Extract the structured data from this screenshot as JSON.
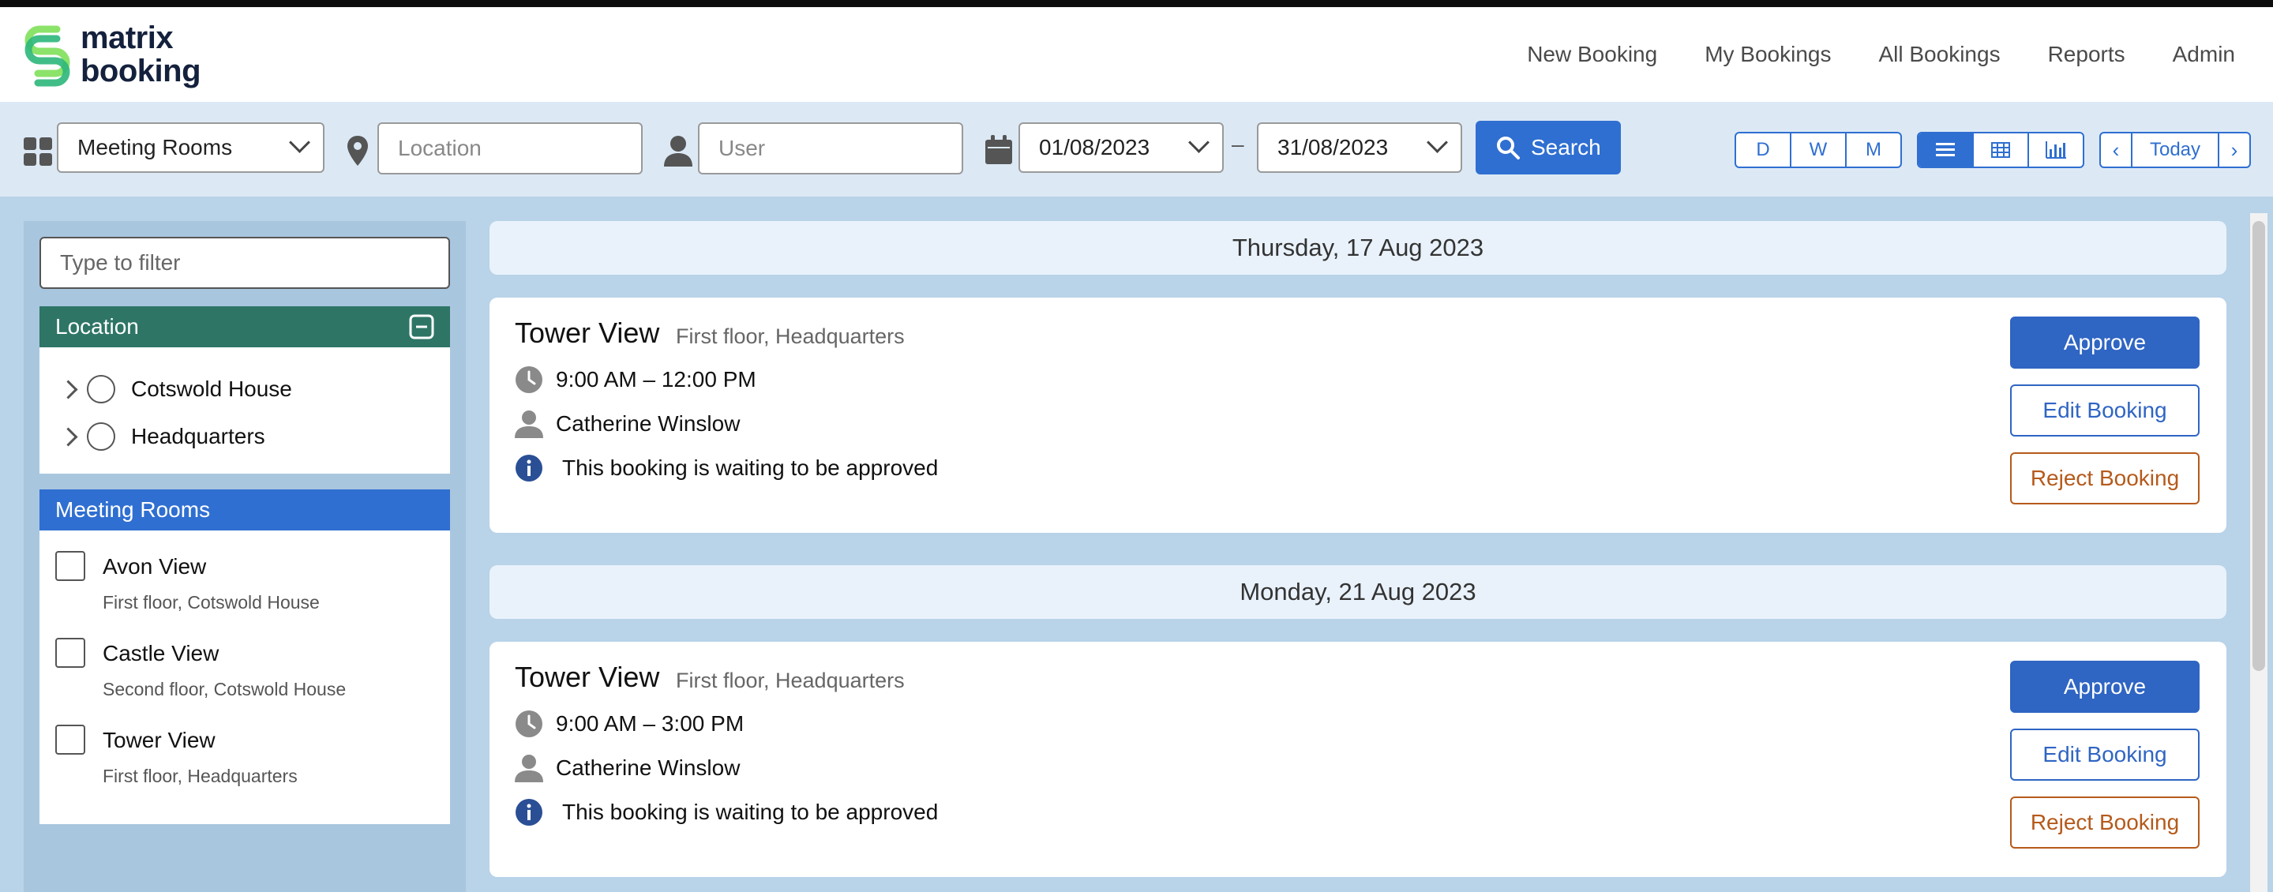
{
  "brand": {
    "line1": "matrix",
    "line2": "booking",
    "colors": {
      "logo_green_light": "#8ce36a",
      "logo_green": "#2cb77a",
      "text": "#14213d"
    }
  },
  "nav": {
    "items": [
      "New Booking",
      "My Bookings",
      "All Bookings",
      "Reports",
      "Admin"
    ]
  },
  "toolbar": {
    "resource_type": "Meeting Rooms",
    "location_placeholder": "Location",
    "user_placeholder": "User",
    "date_from": "01/08/2023",
    "date_separator": "–",
    "date_to": "31/08/2023",
    "search_label": "Search",
    "view_periods": [
      "D",
      "W",
      "M"
    ],
    "view_modes_icons": [
      "list-icon",
      "grid-icon",
      "chart-icon"
    ],
    "active_view_mode": "list",
    "today_label": "Today",
    "accent": "#2f6fd1"
  },
  "sidebar": {
    "filter_placeholder": "Type to filter",
    "location_panel": {
      "title": "Location",
      "color": "#2e7566",
      "items": [
        "Cotswold House",
        "Headquarters"
      ]
    },
    "rooms_panel": {
      "title": "Meeting Rooms",
      "color": "#2f6fd1",
      "items": [
        {
          "name": "Avon View",
          "detail": "First floor, Cotswold House"
        },
        {
          "name": "Castle View",
          "detail": "Second floor, Cotswold House"
        },
        {
          "name": "Tower View",
          "detail": "First floor, Headquarters"
        }
      ]
    }
  },
  "bookings": [
    {
      "date": "Thursday, 17 Aug 2023",
      "room": "Tower View",
      "location": "First floor, Headquarters",
      "time": "9:00 AM – 12:00 PM",
      "user": "Catherine Winslow",
      "status": "This booking is waiting to be approved",
      "approve_label": "Approve",
      "edit_label": "Edit Booking",
      "reject_label": "Reject Booking"
    },
    {
      "date": "Monday, 21 Aug 2023",
      "room": "Tower View",
      "location": "First floor, Headquarters",
      "time": "9:00 AM – 3:00 PM",
      "user": "Catherine Winslow",
      "status": "This booking is waiting to be approved",
      "approve_label": "Approve",
      "edit_label": "Edit Booking",
      "reject_label": "Reject Booking"
    }
  ]
}
